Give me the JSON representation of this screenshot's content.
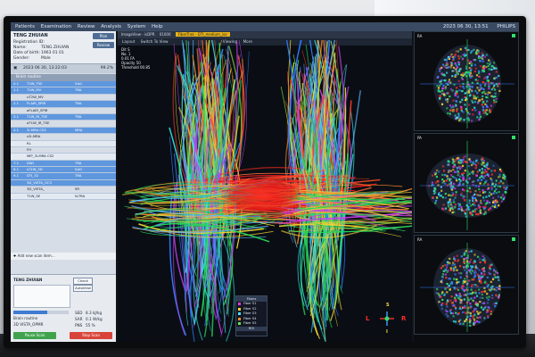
{
  "menu": [
    "Patients",
    "Examination",
    "Review",
    "Analysis",
    "System",
    "Help"
  ],
  "clock": "2023 06 30, 13:51",
  "brand": "PHILIPS",
  "patient": {
    "name": "TENG ZHUIAN",
    "registration_label": "Registration ID:",
    "name_label": "Name:",
    "name_value": "TENG ZHUIAN",
    "dob_label": "Date of birth:",
    "dob_value": "1963 01 01",
    "gender_label": "Gender:",
    "gender_value": "Male",
    "plan_btn": "Plan",
    "review_btn": "Review"
  },
  "exam": {
    "date": "2023 06 30, 13:22:03",
    "progress": "99.2%"
  },
  "seq_header": "Brain routine",
  "sequences": [
    {
      "id": "0.1",
      "name": "T2W_TSE",
      "ori": "SAG",
      "sel": true
    },
    {
      "id": "1.1",
      "name": "T2W_MV",
      "ori": "TRA",
      "sel": true
    },
    {
      "id": "",
      "name": "uT2W_MV",
      "ori": "",
      "sel": false
    },
    {
      "id": "2.1",
      "name": "FLAIR_SPIR",
      "ori": "TRA",
      "sel": true
    },
    {
      "id": "",
      "name": "aFLAIR_SPIR",
      "ori": "",
      "sel": false
    },
    {
      "id": "3.1",
      "name": "T1W_IR_TSE",
      "ori": "TRA",
      "sel": true
    },
    {
      "id": "",
      "name": "aT1W_IR_TSE",
      "ori": "",
      "sel": false
    },
    {
      "id": "4.1",
      "name": "3i-MRA CS2",
      "ori": "MRA",
      "sel": true
    },
    {
      "id": "",
      "name": "s3i-MRA",
      "ori": "",
      "sel": false
    },
    {
      "id": "",
      "name": "RL",
      "ori": "",
      "sel": false
    },
    {
      "id": "",
      "name": "FH",
      "ori": "",
      "sel": false
    },
    {
      "id": "",
      "name": "MIP_3i-MRA CS2",
      "ori": "",
      "sel": false
    },
    {
      "id": "7.1",
      "name": "DWI",
      "ori": "TRA",
      "sel": true
    },
    {
      "id": "8.1",
      "name": "sT1W_3D",
      "ori": "SAG",
      "sel": true
    },
    {
      "id": "9.1",
      "name": "DTI_32",
      "ori": "TRA",
      "sel": true
    },
    {
      "id": "",
      "name": "3D_VISTA_OC3",
      "ori": "",
      "sel": true
    },
    {
      "id": "",
      "name": "3D_VISTA_",
      "ori": "SR",
      "sel": false
    },
    {
      "id": "",
      "name": "T1W_SE",
      "ori": "N-TRA",
      "sel": false
    }
  ],
  "add_new": "Add new scan item...",
  "summary": {
    "name": "TENG ZHUIAN",
    "check_btn": "Check",
    "auto_view": "AutoView",
    "scan_label": "Brain routine",
    "current_scan": "3D VISTA_OPMR",
    "sed_label": "SED",
    "sed_value": "8.3 kJ/kg",
    "sar_label": "SAR",
    "sar_value": "0.1 W/kg",
    "pns_label": "PNS",
    "pns_value": "55 %",
    "progress": 0.62
  },
  "pause_btn": "Pause Scan",
  "stop_btn": "Stop Scan",
  "viewer": {
    "tabs": [
      "ImageView - isDPR",
      "01000",
      "FiberTrak - DTI_medium_iso"
    ],
    "toolbar": [
      "Layout",
      "Switch To View",
      "Viewing",
      "More"
    ],
    "info": [
      "Dit S",
      "No. 1",
      "0.01 FA",
      "Opacity 50",
      "Threshold 00.85"
    ]
  },
  "legend": {
    "title": "Fibers",
    "items": [
      {
        "name": "Fiber S1",
        "color": "#e43bd4"
      },
      {
        "name": "Fiber S2",
        "color": "#f2d33a"
      },
      {
        "name": "Fiber S3",
        "color": "#4fdcf2"
      },
      {
        "name": "Fiber S4",
        "color": "#f08b2a"
      },
      {
        "name": "Fiber S5",
        "color": "#6ae04d"
      }
    ],
    "roi": "ROI"
  },
  "orient": {
    "left": "L",
    "right": "R",
    "top": "S",
    "bottom": "I"
  },
  "panes": [
    {
      "label": "RA"
    },
    {
      "label": "PA"
    },
    {
      "label": "RA"
    }
  ]
}
